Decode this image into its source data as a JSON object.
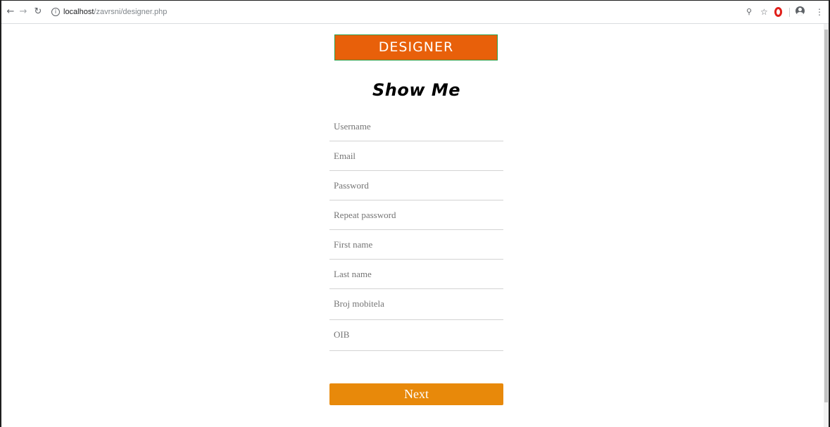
{
  "browser": {
    "url_host": "localhost",
    "url_path": "/zavrsni/designer.php",
    "icons": {
      "back": "back-arrow-icon",
      "forward": "forward-arrow-icon",
      "reload": "reload-icon",
      "info": "info-icon",
      "zoom": "zoom-icon",
      "bookmark": "star-icon",
      "extension": "opera-icon",
      "account": "account-icon",
      "menu": "menu-icon"
    }
  },
  "page": {
    "banner": "DESIGNER",
    "title": "Show Me",
    "fields": [
      {
        "placeholder": "Username",
        "value": ""
      },
      {
        "placeholder": "Email",
        "value": ""
      },
      {
        "placeholder": "Password",
        "value": ""
      },
      {
        "placeholder": "Repeat password",
        "value": ""
      },
      {
        "placeholder": "First name",
        "value": ""
      },
      {
        "placeholder": "Last name",
        "value": ""
      },
      {
        "placeholder": "Broj mobitela",
        "value": ""
      },
      {
        "placeholder": "OIB",
        "value": ""
      }
    ],
    "next_label": "Next"
  },
  "colors": {
    "banner_bg": "#e8600a",
    "banner_border": "#2e9e4a",
    "button_bg": "#e8890a"
  }
}
